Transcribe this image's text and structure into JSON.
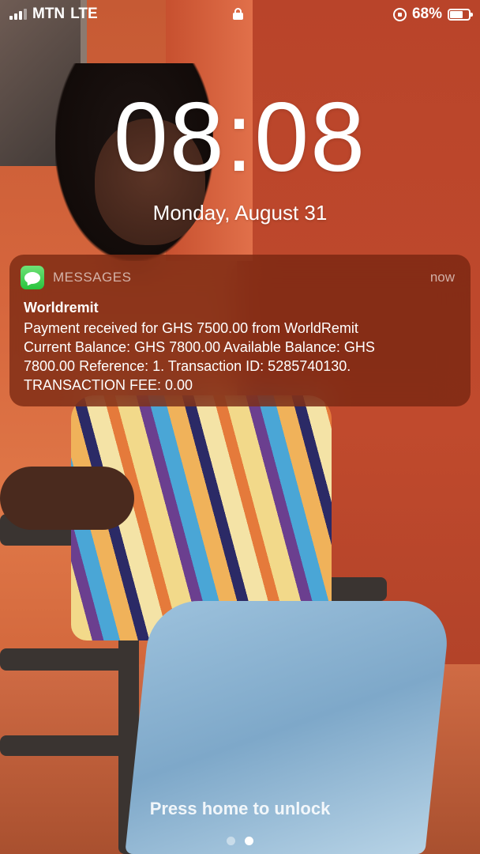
{
  "status_bar": {
    "carrier": "MTN",
    "network": "LTE",
    "signal_bars_active": 3,
    "signal_bars_total": 4,
    "battery_percent_label": "68%",
    "battery_level": 0.68,
    "icons": [
      "signal-icon",
      "lock-icon",
      "rotation-lock-icon",
      "battery-icon"
    ]
  },
  "lock_screen": {
    "time": "08:08",
    "date": "Monday, August 31",
    "unlock_hint": "Press home to unlock",
    "page_count": 2,
    "active_page": 1
  },
  "notification": {
    "app_name": "MESSAGES",
    "time": "now",
    "icon": "messages-app-icon",
    "accent_color": "#28c43d",
    "title": "Worldremit",
    "body": "Payment received for  GHS 7500.00 from WorldRemit\nCurrent Balance: GHS 7800.00 Available Balance: GHS\n7800.00 Reference: 1. Transaction ID: 5285740130.\nTRANSACTION FEE: 0.00"
  }
}
